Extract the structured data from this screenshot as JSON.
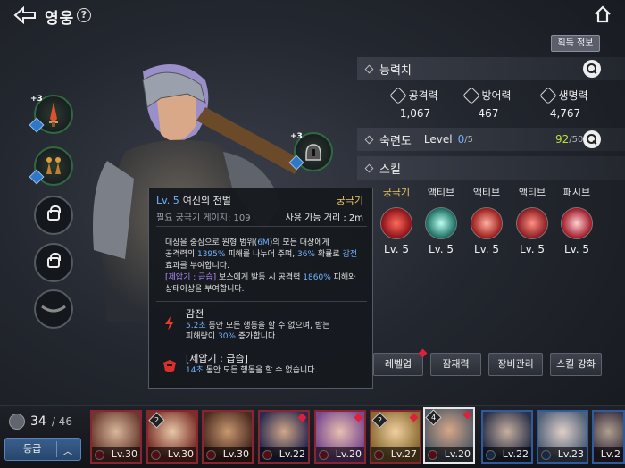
{
  "header": {
    "title": "영웅",
    "help": "?"
  },
  "acquire_button": "획득 정보",
  "stats": {
    "title": "능력치",
    "items": [
      {
        "label": "공격력",
        "value": "1,067"
      },
      {
        "label": "방어력",
        "value": "467"
      },
      {
        "label": "생명력",
        "value": "4,767"
      }
    ]
  },
  "proficiency": {
    "title": "숙련도",
    "level_label": "Level",
    "level": "0",
    "level_max": "/5",
    "points": "92",
    "points_max": "/500"
  },
  "skills": {
    "title": "스킬",
    "items": [
      {
        "type": "궁극기",
        "level": "Lv. 5"
      },
      {
        "type": "액티브",
        "level": "Lv. 5"
      },
      {
        "type": "액티브",
        "level": "Lv. 5"
      },
      {
        "type": "액티브",
        "level": "Lv. 5"
      },
      {
        "type": "패시브",
        "level": "Lv. 5"
      }
    ]
  },
  "actions": {
    "levelup": "레벨업",
    "potential": "잠재력",
    "equip": "장비관리",
    "skill_up": "스킬 강화"
  },
  "equipment": {
    "slot1_plus": "+3",
    "slot6_plus": "+3"
  },
  "tooltip": {
    "level": "Lv. 5",
    "name": "여신의 천벌",
    "category": "궁극기",
    "gauge": "필요 궁극기 게이지: 109",
    "range": "사용 가능 거리 : 2m",
    "desc_line1_a": "대상을 중심으로 원형 범위(",
    "desc_line1_hl": "6M",
    "desc_line1_b": ")의 모든 대상에게",
    "desc_line2_a": "공격력의 ",
    "desc_line2_hl1": "1395%",
    "desc_line2_b": " 피해를 나누어 주며, ",
    "desc_line2_hl2": "36%",
    "desc_line2_c": " 확률로 ",
    "desc_line2_hl3": "감전",
    "desc_line3": "효과를 부여합니다.",
    "desc_line4_hl": "[제압기 : 급습]",
    "desc_line4_a": " 보스에게 발동 시 공격력 ",
    "desc_line4_hl2": "1860%",
    "desc_line4_b": " 피해와",
    "desc_line5": "상태이상을 부여합니다.",
    "effect1_title": "감전",
    "effect1_hl": "5.2초",
    "effect1_a": " 동안 모든 행동을 할 수 없으며, 받는",
    "effect1_b": "피해량이 ",
    "effect1_hl2": "30%",
    "effect1_c": " 증가합니다.",
    "effect2_title": "[제압기 : 급습]",
    "effect2_hl": "14초",
    "effect2_a": " 동안 모든 행동을 할 수 없습니다."
  },
  "roster": {
    "count": "34",
    "max": "/ 46",
    "grade_button": "등급",
    "heroes": [
      {
        "level": "Lv.30"
      },
      {
        "level": "Lv.30",
        "stars": "2"
      },
      {
        "level": "Lv.30"
      },
      {
        "level": "Lv.22"
      },
      {
        "level": "Lv.20"
      },
      {
        "level": "Lv.27",
        "stars": "2"
      },
      {
        "level": "Lv.20",
        "stars": "4"
      },
      {
        "level": "Lv.22"
      },
      {
        "level": "Lv.23"
      },
      {
        "level": "Lv.2"
      }
    ]
  },
  "colors": {
    "accent_blue": "#6fb4ff",
    "accent_gold": "#f0c860",
    "alert_red": "#e0203a"
  }
}
